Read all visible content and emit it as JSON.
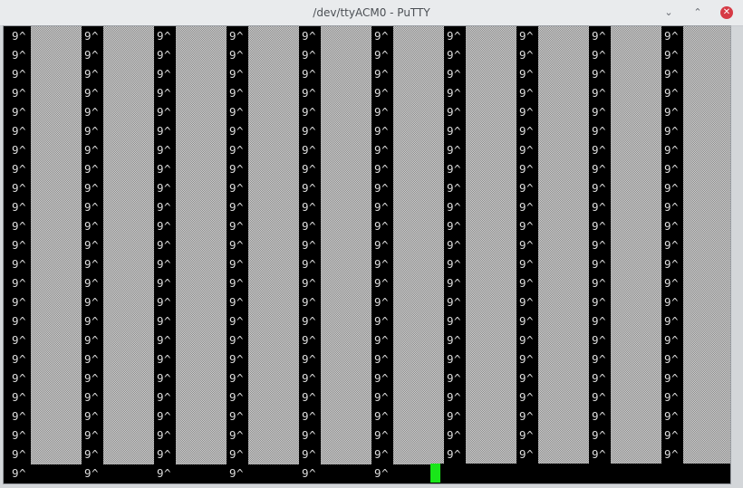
{
  "window": {
    "title": "/dev/ttyACM0 - PuTTY",
    "controls": {
      "minimize_icon": "minimize-icon",
      "maximize_icon": "restore-icon",
      "close_icon": "close-icon",
      "minimize_glyph": "⌄",
      "maximize_glyph": "⌃",
      "close_glyph": "✕"
    }
  },
  "terminal": {
    "pattern_text": "9^",
    "colors": {
      "background": "#000000",
      "foreground": "#dcdcdc",
      "shade": "#d0d0d0",
      "cursor": "#19e619"
    },
    "columns": 10,
    "full_rows": 23,
    "last_row_columns": 6
  }
}
